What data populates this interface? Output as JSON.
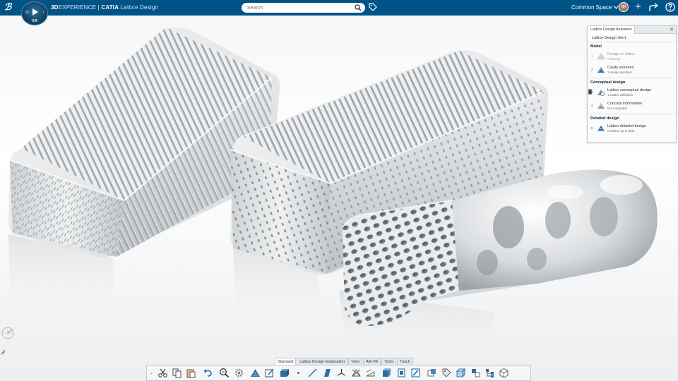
{
  "header": {
    "brand_prefix": "3D",
    "brand_name": "EXPERIENCE",
    "separator": " | ",
    "product": "CATIA",
    "app": "Lattice Design",
    "compass_version": "V.R",
    "compass_left": "3D",
    "compass_right": "i",
    "search_placeholder": "Search",
    "space": "Common Space",
    "avatar_initials": "HH",
    "background_color": "#005386"
  },
  "assistant": {
    "tab_label": "Lattice Design Assistant",
    "set_name": "Lattice Design Set.1",
    "sections": [
      {
        "title": "Model",
        "steps": [
          {
            "num": "1",
            "title": "Design to lattice",
            "subtitle": "PartBody",
            "dim": true,
            "icon": "lattice-body-icon"
          },
          {
            "num": "2",
            "title": "Cavity volumes",
            "subtitle": "1 cavity specified",
            "dim": false,
            "icon": "cavity-volume-icon"
          }
        ]
      },
      {
        "title": "Conceptual design",
        "steps": [
          {
            "num": "3",
            "title": "Lattice conceptual design",
            "subtitle": "1 Lattice definition",
            "dim": false,
            "icon": "lattice-conceptual-icon",
            "trash": true
          },
          {
            "num": "4",
            "title": "Concept information",
            "subtitle": "Not computed",
            "dim": false,
            "icon": "concept-info-icon"
          }
        ]
      },
      {
        "title": "Detailed design",
        "steps": [
          {
            "num": "5",
            "title": "Lattice detailed design",
            "subtitle": "Created, up to date",
            "dim": false,
            "icon": "lattice-detailed-icon"
          }
        ]
      }
    ]
  },
  "toolbar": {
    "tabs": [
      {
        "label": "Standard",
        "active": true
      },
      {
        "label": "Lattice Design Exploration",
        "active": false
      },
      {
        "label": "View",
        "active": false
      },
      {
        "label": "AR-VR",
        "active": false
      },
      {
        "label": "Tools",
        "active": false
      },
      {
        "label": "Touch",
        "active": false
      }
    ],
    "icons": [
      "expand-icon",
      "cut-icon",
      "copy-icon",
      "paste-icon",
      "undo-icon",
      "zoom-icon",
      "settings-icon",
      "lattice-assistant-icon",
      "edit-icon",
      "compute-icon",
      "point-icon",
      "line-icon",
      "plane-icon",
      "axis-icon",
      "lattice-cell-icon",
      "measure-icon",
      "view-front-icon",
      "view-box-icon",
      "view-section-icon",
      "layout-icon",
      "tag-icon",
      "cube-icon",
      "assembly-icon",
      "tree-icon",
      "package-icon"
    ]
  },
  "colors": {
    "accent": "#005386",
    "icon_blue": "#2c6ea3",
    "model_light": "#ffffff",
    "model_shadow": "#9aa0a6"
  }
}
